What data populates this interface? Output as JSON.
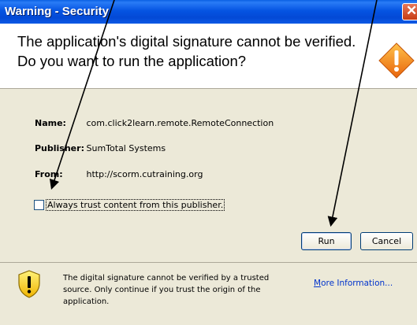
{
  "window": {
    "title": "Warning - Security"
  },
  "header": {
    "headline": "The application's digital signature cannot be verified. Do you want to run the application?"
  },
  "details": {
    "name_label": "Name:",
    "name_value": "com.click2learn.remote.RemoteConnection",
    "publisher_label": "Publisher:",
    "publisher_value": "SumTotal Systems",
    "from_label": "From:",
    "from_value": "http://scorm.cutraining.org"
  },
  "trust_checkbox": {
    "label": "Always trust content from this publisher.",
    "checked": false
  },
  "buttons": {
    "run": "Run",
    "cancel": "Cancel"
  },
  "footer": {
    "message": "The digital signature cannot be verified by a trusted source.  Only continue if you trust the origin of the application.",
    "more_info_accel": "M",
    "more_info_rest": "ore Information..."
  },
  "icons": {
    "header": "warning-diamond-icon",
    "footer": "warning-shield-icon",
    "close": "close-icon"
  },
  "colors": {
    "titlebar": "#0554e2",
    "warning_orange": "#f28a1a",
    "link": "#0033cc",
    "annotation": "#000000"
  }
}
